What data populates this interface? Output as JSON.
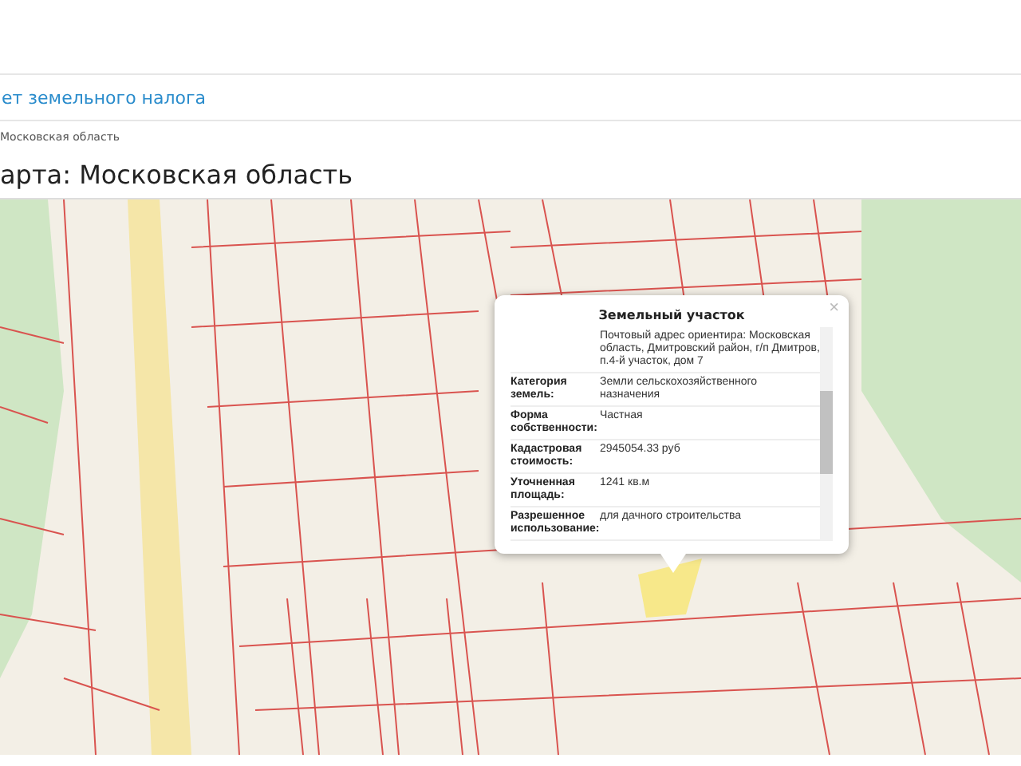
{
  "nav_link": {
    "label": "ет земельного налога"
  },
  "breadcrumb": "Московская область",
  "page_title": "арта: Московская область",
  "map": {
    "popup": {
      "title": "Земельный участок",
      "close": "×",
      "rows": [
        {
          "label": "",
          "value": "Почтовый адрес ориентира: Московская область, Дмитровский район, г/п Дмитров, п.4-й участок, дом 7"
        },
        {
          "label": "Категория земель:",
          "value": "Земли сельскохозяйственного назначения"
        },
        {
          "label": "Форма собственности:",
          "value": "Частная"
        },
        {
          "label": "Кадастровая стоимость:",
          "value": "2945054.33 руб"
        },
        {
          "label": "Уточненная площадь:",
          "value": "1241 кв.м"
        },
        {
          "label": "Разрешенное использование:",
          "value": "для дачного строительства"
        }
      ]
    }
  }
}
